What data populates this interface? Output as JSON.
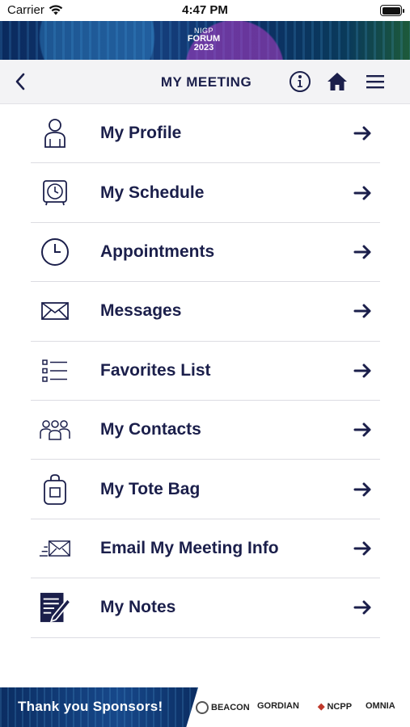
{
  "status_bar": {
    "carrier": "Carrier",
    "time": "4:47 PM"
  },
  "banner": {
    "line1": "NIGP",
    "line2": "FORUM",
    "line3": "2023"
  },
  "nav": {
    "title": "MY MEETING",
    "back_icon": "chevron-left-icon",
    "info_icon": "info-icon",
    "home_icon": "home-icon",
    "menu_icon": "hamburger-menu-icon"
  },
  "menu": {
    "items": [
      {
        "label": "My Profile",
        "icon": "person-icon"
      },
      {
        "label": "My Schedule",
        "icon": "alarm-clock-icon"
      },
      {
        "label": "Appointments",
        "icon": "clock-icon"
      },
      {
        "label": "Messages",
        "icon": "envelope-icon"
      },
      {
        "label": "Favorites List",
        "icon": "checklist-icon"
      },
      {
        "label": "My Contacts",
        "icon": "group-icon"
      },
      {
        "label": "My Tote Bag",
        "icon": "bag-icon"
      },
      {
        "label": "Email My Meeting Info",
        "icon": "send-mail-icon"
      },
      {
        "label": "My Notes",
        "icon": "notes-icon"
      }
    ]
  },
  "footer": {
    "text": "Thank you Sponsors!",
    "sponsors": [
      "BEACON",
      "GORDIAN",
      "NCPP",
      "OMNIA"
    ]
  },
  "colors": {
    "navy": "#1b1f4b",
    "nav_bg": "#f3f3f5",
    "banner": "#0b2d62"
  }
}
